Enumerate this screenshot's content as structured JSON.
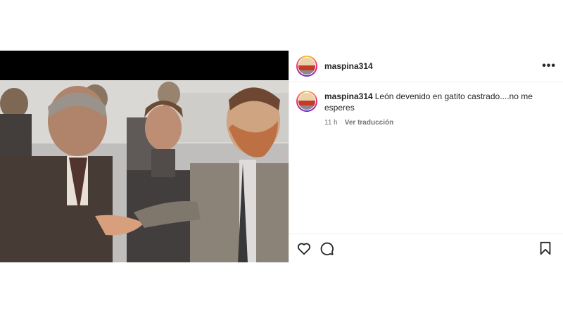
{
  "post": {
    "username": "maspina314",
    "caption": "León devenido en gatito castrado....no me esperes",
    "time": "11 h",
    "translate_label": "Ver traducción"
  },
  "icons": {
    "more": "more-options-icon",
    "like": "heart-icon",
    "comment": "comment-icon",
    "save": "bookmark-icon"
  },
  "colors": {
    "story_ring_start": "#f9ce34",
    "story_ring_mid": "#ee2a7b",
    "story_ring_end": "#6228d7"
  }
}
